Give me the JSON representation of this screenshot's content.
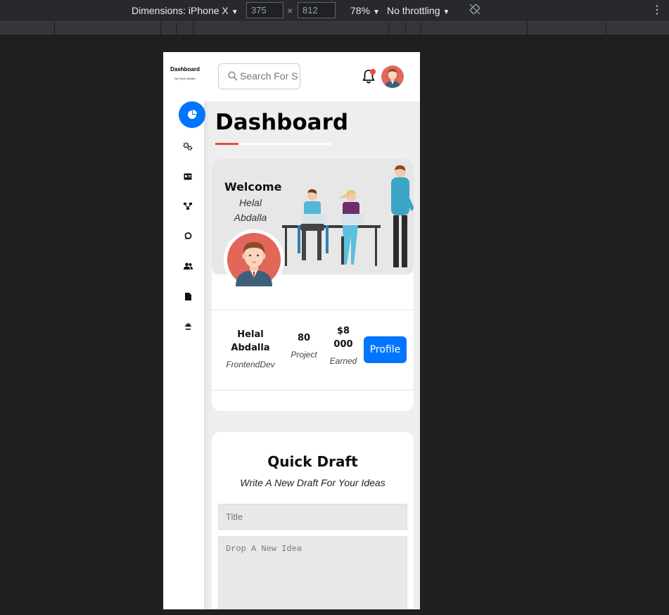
{
  "devtools": {
    "device_label": "Dimensions: iPhone X",
    "width_value": "375",
    "times": "×",
    "height_value": "812",
    "zoom": "78%",
    "throttle": "No throttling",
    "rotate_icon": "rotate-icon",
    "menu_icon": "more-vert-icon"
  },
  "sidebar": {
    "brand": "Dashboard",
    "byline": "By Helal Abdalla",
    "items": [
      {
        "icon": "dashboard-pie-icon",
        "active": true
      },
      {
        "icon": "settings-gears-icon",
        "active": false
      },
      {
        "icon": "profile-card-icon",
        "active": false
      },
      {
        "icon": "projects-diagram-icon",
        "active": false
      },
      {
        "icon": "courses-chat-icon",
        "active": false
      },
      {
        "icon": "friends-users-icon",
        "active": false
      },
      {
        "icon": "files-icon",
        "active": false
      },
      {
        "icon": "plans-icon",
        "active": false
      }
    ]
  },
  "header": {
    "search_placeholder": "Search For Something",
    "notification_icon": "bell-icon",
    "avatar_icon": "avatar"
  },
  "page": {
    "title": "Dashboard"
  },
  "welcome": {
    "title": "Welcome",
    "name": "Helal Abdalla",
    "stats": [
      {
        "value": "Helal Abdalla",
        "label": "FrontendDev"
      },
      {
        "value": "80",
        "label": "Project"
      },
      {
        "value": "$8 000",
        "label": "Earned"
      }
    ],
    "button": "Profile"
  },
  "quick_draft": {
    "title": "Quick Draft",
    "subtitle": "Write A New Draft For Your Ideas",
    "title_placeholder": "Title",
    "idea_placeholder": "Drop A New Idea"
  },
  "colors": {
    "accent": "#0075ff",
    "underline_red": "#e74c3c",
    "notification_dot": "#f44336"
  }
}
